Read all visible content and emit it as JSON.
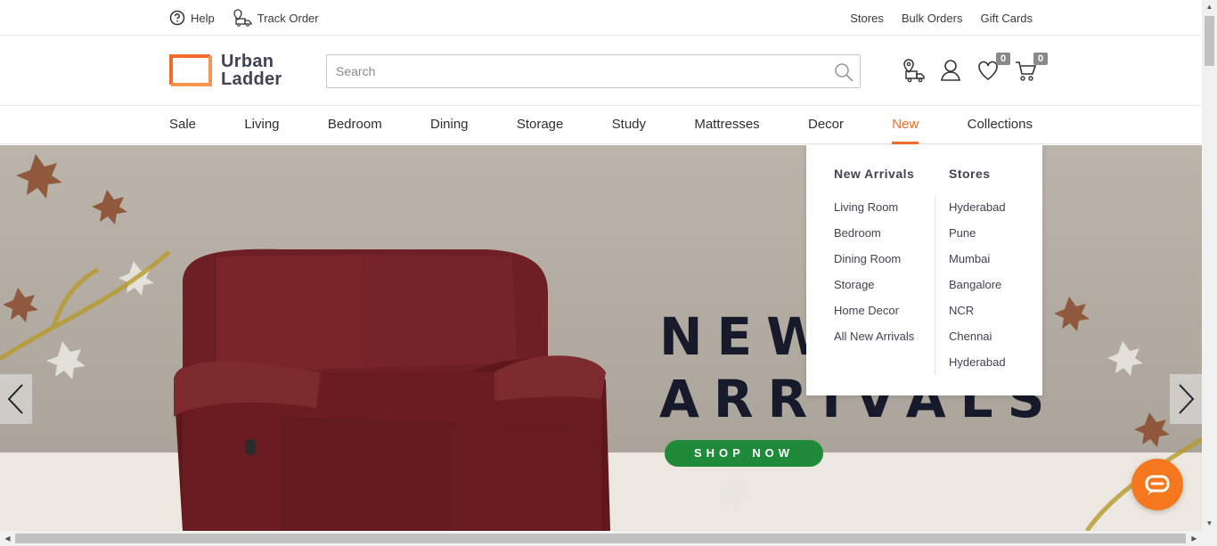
{
  "topbar": {
    "help": "Help",
    "track_order": "Track Order",
    "stores": "Stores",
    "bulk_orders": "Bulk Orders",
    "gift_cards": "Gift Cards"
  },
  "logo": {
    "line1": "Urban",
    "line2": "Ladder"
  },
  "search": {
    "placeholder": "Search"
  },
  "header_icons": {
    "wishlist_count": "0",
    "cart_count": "0"
  },
  "nav": {
    "items": [
      "Sale",
      "Living",
      "Bedroom",
      "Dining",
      "Storage",
      "Study",
      "Mattresses",
      "Decor",
      "New",
      "Collections"
    ],
    "active": "New"
  },
  "dropdown": {
    "new_arrivals": {
      "heading": "New Arrivals",
      "links": [
        "Living Room",
        "Bedroom",
        "Dining Room",
        "Storage",
        "Home Decor",
        "All New Arrivals"
      ]
    },
    "stores": {
      "heading": "Stores",
      "links": [
        "Hyderabad",
        "Pune",
        "Mumbai",
        "Bangalore",
        "NCR",
        "Chennai",
        "Hyderabad"
      ]
    }
  },
  "hero": {
    "line1": "NEW",
    "line2": "ARRIVALS",
    "cta": "SHOP NOW"
  },
  "colors": {
    "accent": "#f26b2b",
    "cta_green": "#1f8a3a",
    "chat": "#f5781f"
  }
}
